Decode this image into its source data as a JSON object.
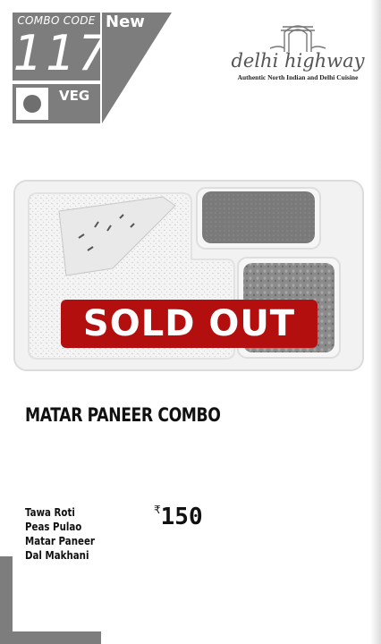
{
  "combo": {
    "code_label": "COMBO CODE",
    "code": "117",
    "new_label": "New",
    "diet_label": "VEG"
  },
  "brand": {
    "name": "delhi highway",
    "tagline": "Authentic North Indian and Delhi Cuisine",
    "icon": "india-gate-icon"
  },
  "status": {
    "sold_out_label": "SOLD OUT",
    "color": "#b40f0f"
  },
  "product": {
    "title": "MATAR PANEER COMBO",
    "items": [
      "Tawa Roti",
      "Peas Pulao",
      "Matar Paneer",
      "Dal Makhani"
    ],
    "currency_symbol": "₹",
    "price": "150"
  },
  "colors": {
    "panel_gray": "#7d7d7d"
  }
}
